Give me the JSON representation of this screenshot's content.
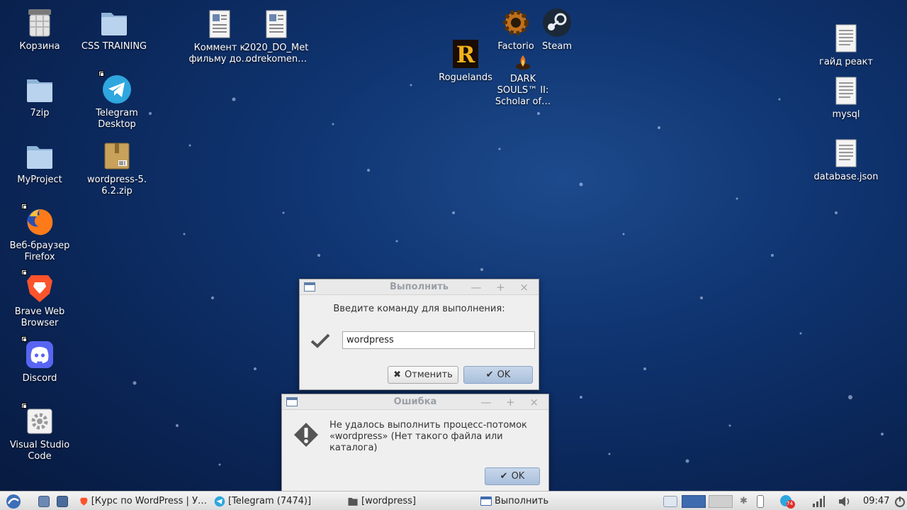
{
  "desktop": {
    "icons": [
      {
        "label": "Корзина",
        "icon": "trash-icon"
      },
      {
        "label": "CSS TRAINING",
        "icon": "folder-icon"
      },
      {
        "label": "Коммент к фильму до…",
        "icon": "document-icon"
      },
      {
        "label": "2020_DO_Metodrekomen…",
        "icon": "document-icon"
      },
      {
        "label": "Factorio",
        "icon": "gear-icon"
      },
      {
        "label": "Steam",
        "icon": "steam-icon"
      },
      {
        "label": "Roguelands",
        "icon": "roguelands-icon"
      },
      {
        "label": "DARK SOULS™ II: Scholar of…",
        "icon": "campfire-icon"
      },
      {
        "label": "7zip",
        "icon": "folder-icon"
      },
      {
        "label": "Telegram Desktop",
        "icon": "telegram-icon"
      },
      {
        "label": "MyProject",
        "icon": "folder-icon"
      },
      {
        "label": "wordpress-5.6.2.zip",
        "icon": "archive-icon"
      },
      {
        "label": "Веб-браузер Firefox",
        "icon": "firefox-icon"
      },
      {
        "label": "Brave Web Browser",
        "icon": "brave-icon"
      },
      {
        "label": "Discord",
        "icon": "discord-icon"
      },
      {
        "label": "Visual Studio Code",
        "icon": "settings-icon"
      },
      {
        "label": "гайд реакт",
        "icon": "text-file-icon"
      },
      {
        "label": "mysql",
        "icon": "text-file-icon"
      },
      {
        "label": "database.json",
        "icon": "text-file-icon"
      }
    ]
  },
  "run_dialog": {
    "title": "Выполнить",
    "prompt": "Введите команду для выполнения:",
    "input_value": "wordpress",
    "cancel_label": "Отменить",
    "ok_label": "OK",
    "window_controls": "— + ×"
  },
  "error_dialog": {
    "title": "Ошибка",
    "message_line1": "Не удалось выполнить процесс-потомок",
    "message_line2": "«wordpress» (Нет такого файла или каталога)",
    "ok_label": "OK",
    "window_controls": "— + ×"
  },
  "taskbar": {
    "tasks": [
      {
        "label": "[Курс по WordPress | У…",
        "icon": "brave-icon"
      },
      {
        "label": "[Telegram (7474)]",
        "icon": "telegram-icon"
      },
      {
        "label": "[wordpress]",
        "icon": "folder-icon"
      },
      {
        "label": "Выполнить",
        "icon": "window-icon"
      }
    ],
    "tray_badge": "74",
    "clock": "09:47"
  },
  "colors": {
    "desktop_bg": "#0f3470",
    "primary_button": "#a9bfdc",
    "taskbar_bg": "#e6e6e6"
  }
}
